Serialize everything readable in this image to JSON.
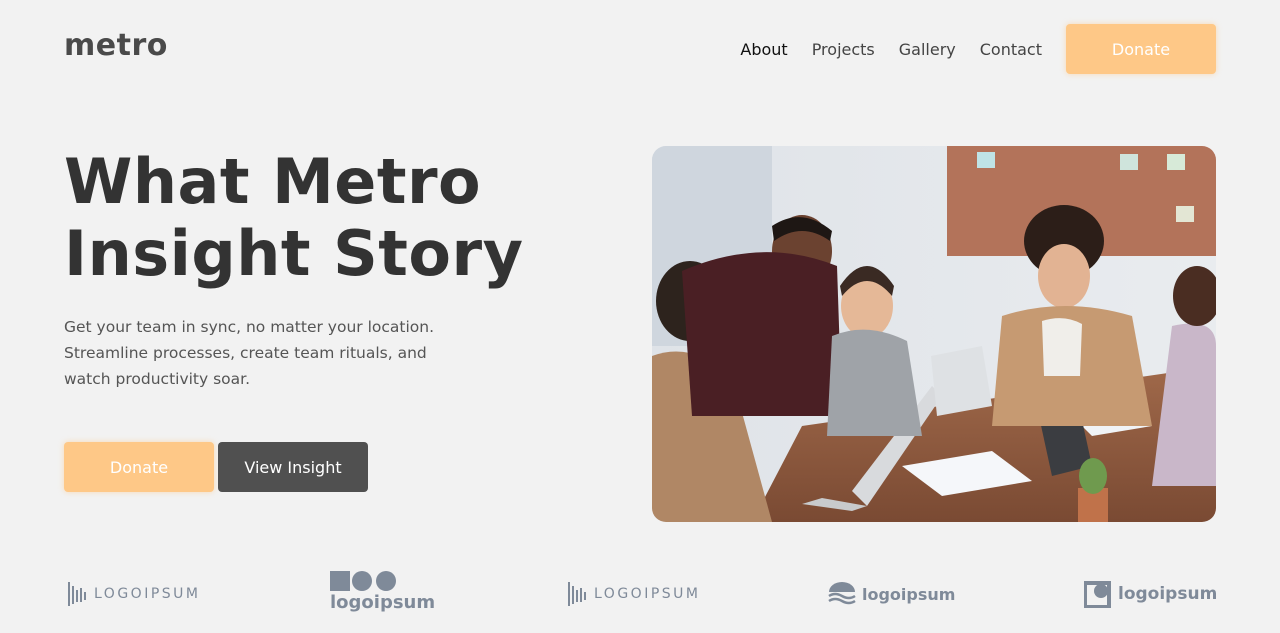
{
  "brand": {
    "name": "metro"
  },
  "nav": {
    "items": [
      {
        "label": "About"
      },
      {
        "label": "Projects"
      },
      {
        "label": "Gallery"
      },
      {
        "label": "Contact"
      }
    ],
    "donate_label": "Donate"
  },
  "hero": {
    "title_line1": "What Metro",
    "title_line2": "Insight Story",
    "subtitle_line1": "Get your team in sync, no matter your location.",
    "subtitle_line2": "Streamline processes, create team rituals, and",
    "subtitle_line3": "watch productivity soar.",
    "donate_label": "Donate",
    "view_label": "View Insight",
    "image_icon": "team-meeting-photo"
  },
  "logos": [
    {
      "text": "LOGOIPSUM"
    },
    {
      "text": "logoipsum"
    },
    {
      "text": "LOGOIPSUM"
    },
    {
      "text": "logoipsum"
    },
    {
      "text": "logoipsum"
    }
  ],
  "colors": {
    "accent": "#fec887",
    "dark_button": "#505050",
    "background": "#f2f2f2",
    "logo_gray": "#7f8a99"
  }
}
